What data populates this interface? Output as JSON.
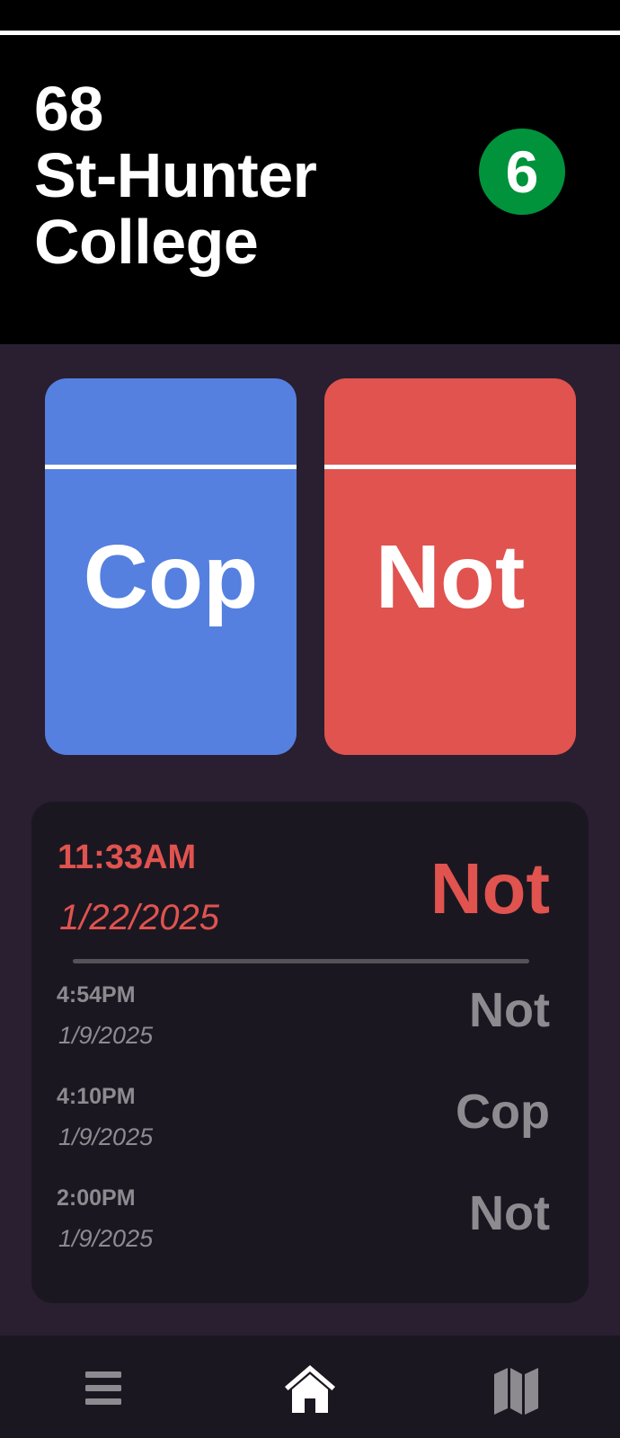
{
  "station": {
    "name_lines": [
      "68",
      "St-Hunter",
      "College"
    ],
    "route": "6",
    "route_color": "#00933c"
  },
  "vote_buttons": {
    "cop_label": "Cop",
    "not_label": "Not",
    "cop_color": "#5580e0",
    "not_color": "#e0534f"
  },
  "history": {
    "latest": {
      "time": "11:33AM",
      "date": "1/22/2025",
      "status": "Not"
    },
    "entries": [
      {
        "time": "4:54PM",
        "date": "1/9/2025",
        "status": "Not"
      },
      {
        "time": "4:10PM",
        "date": "1/9/2025",
        "status": "Cop"
      },
      {
        "time": "2:00PM",
        "date": "1/9/2025",
        "status": "Not"
      }
    ]
  },
  "nav": {
    "items": [
      {
        "icon": "menu-icon",
        "active": false
      },
      {
        "icon": "home-icon",
        "active": true
      },
      {
        "icon": "map-icon",
        "active": false
      }
    ]
  }
}
